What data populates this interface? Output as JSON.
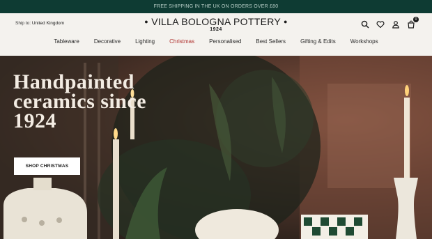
{
  "announcement": "FREE SHIPPING IN THE UK ON ORDERS OVER £80",
  "ship_to": {
    "label": "Ship to:",
    "country": "United Kingdom"
  },
  "logo": {
    "title": "VILLA BOLOGNA POTTERY",
    "year": "1924"
  },
  "icons": [
    "search-icon",
    "heart-icon",
    "user-icon",
    "cart-icon"
  ],
  "cart_count": "0",
  "nav": [
    {
      "label": "Tableware"
    },
    {
      "label": "Decorative"
    },
    {
      "label": "Lighting"
    },
    {
      "label": "Christmas"
    },
    {
      "label": "Personalised"
    },
    {
      "label": "Best Sellers"
    },
    {
      "label": "Gifting & Edits"
    },
    {
      "label": "Workshops"
    }
  ],
  "hero": {
    "headline": "Handpainted ceramics since 1924",
    "cta": "SHOP CHRISTMAS"
  },
  "colors": {
    "announcement_bg": "#0e3b33",
    "highlight": "#b0322f"
  }
}
